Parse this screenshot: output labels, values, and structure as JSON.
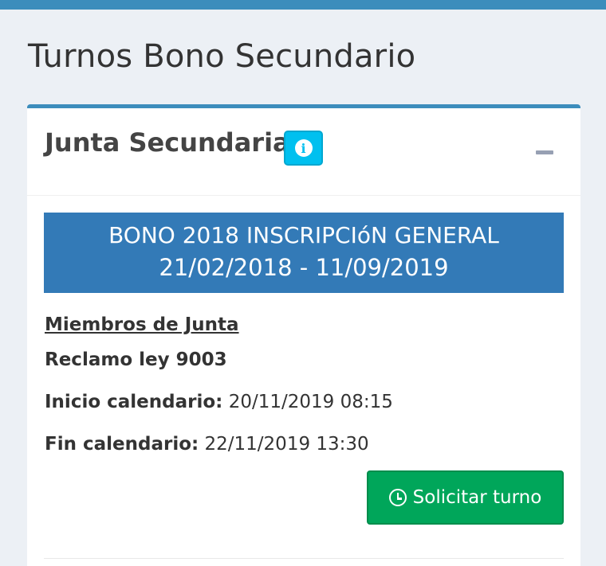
{
  "page": {
    "title": "Turnos Bono Secundario"
  },
  "box": {
    "title": "Junta Secundaria",
    "info_icon": "info-icon",
    "collapse_icon": "minus-icon"
  },
  "banner": {
    "line1": "BONO 2018 INSCRIPCIóN GENERAL",
    "line2": "21/02/2018 - 11/09/2019"
  },
  "details": {
    "members_link": "Miembros de Junta",
    "reclamo": "Reclamo ley 9003",
    "inicio_label": "Inicio calendario:",
    "inicio_value": "20/11/2019 08:15",
    "fin_label": "Fin calendario:",
    "fin_value": "22/11/2019 13:30"
  },
  "actions": {
    "solicitar_label": "Solicitar turno",
    "solicitar_icon": "clock-icon"
  },
  "colors": {
    "primary": "#3c8dbc",
    "banner": "#337ab7",
    "info": "#00c0ef",
    "success": "#00a65a"
  }
}
